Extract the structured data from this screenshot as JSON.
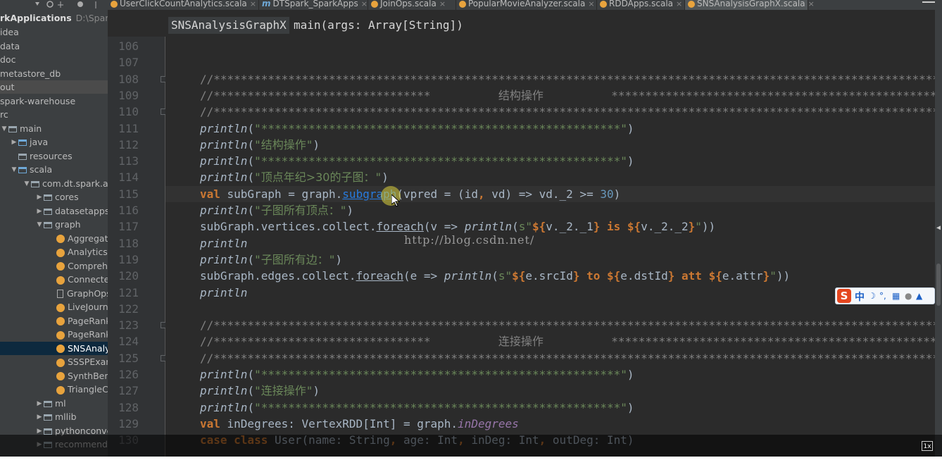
{
  "tabs": [
    {
      "label": "UserClickCountAnalytics.scala",
      "icon": "scala",
      "active": false
    },
    {
      "label": "DTSpark_SparkApps",
      "icon": "module",
      "active": false
    },
    {
      "label": "JoinOps.scala",
      "icon": "scala",
      "active": false
    },
    {
      "label": "PopularMovieAnalyzer.scala",
      "icon": "scala",
      "active": false
    },
    {
      "label": "RDDApps.scala",
      "icon": "scala",
      "active": false
    },
    {
      "label": "SNSAnalysisGraphX.scala",
      "icon": "scala",
      "active": true
    }
  ],
  "tab_close_glyph": "×",
  "project": {
    "name": "rkApplications",
    "path": "D:\\SparkA"
  },
  "tree": [
    {
      "label": "idea",
      "arrow": "",
      "icon": "none"
    },
    {
      "label": "data",
      "arrow": "",
      "icon": "none"
    },
    {
      "label": "doc",
      "arrow": "",
      "icon": "none"
    },
    {
      "label": "metastore_db",
      "arrow": "",
      "icon": "none"
    },
    {
      "label": "out",
      "arrow": "",
      "icon": "none"
    },
    {
      "label": "spark-warehouse",
      "arrow": "",
      "icon": "none"
    },
    {
      "label": "rc",
      "arrow": "",
      "icon": "none"
    },
    {
      "label": "main",
      "arrow": "▼",
      "icon": "folder"
    },
    {
      "label": "java",
      "arrow": "▶",
      "icon": "folder-blue"
    },
    {
      "label": "resources",
      "arrow": "",
      "icon": "folder"
    },
    {
      "label": "scala",
      "arrow": "▼",
      "icon": "folder-blue"
    },
    {
      "label": "com.dt.spark.apps",
      "arrow": "▼",
      "icon": "folder"
    },
    {
      "label": "cores",
      "arrow": "▶",
      "icon": "folder"
    },
    {
      "label": "datasetapps",
      "arrow": "▶",
      "icon": "folder"
    },
    {
      "label": "graph",
      "arrow": "▼",
      "icon": "folder"
    },
    {
      "label": "AggregateM",
      "arrow": "",
      "icon": "scala"
    },
    {
      "label": "Analytics",
      "arrow": "",
      "icon": "scala"
    },
    {
      "label": "Comprehen",
      "arrow": "",
      "icon": "scala"
    },
    {
      "label": "Connected",
      "arrow": "",
      "icon": "scala"
    },
    {
      "label": "GraphOpsIn",
      "arrow": "",
      "icon": "file"
    },
    {
      "label": "LiveJournal",
      "arrow": "",
      "icon": "scala"
    },
    {
      "label": "PageRankA",
      "arrow": "",
      "icon": "scala"
    },
    {
      "label": "PageRankE",
      "arrow": "",
      "icon": "scala"
    },
    {
      "label": "SNSAnalysi",
      "arrow": "",
      "icon": "scala"
    },
    {
      "label": "SSSPExamp",
      "arrow": "",
      "icon": "scala"
    },
    {
      "label": "SynthBench",
      "arrow": "",
      "icon": "scala"
    },
    {
      "label": "TriangleCou",
      "arrow": "",
      "icon": "scala"
    },
    {
      "label": "ml",
      "arrow": "▶",
      "icon": "folder"
    },
    {
      "label": "mllib",
      "arrow": "▶",
      "icon": "folder"
    },
    {
      "label": "pythonconvert",
      "arrow": "▶",
      "icon": "folder"
    },
    {
      "label": "recommendati",
      "arrow": "▶",
      "icon": "folder"
    }
  ],
  "breadcrumb": {
    "class_name": "SNSAnalysisGraphX",
    "method": "main(args: Array[String])"
  },
  "line_numbers": [
    "106",
    "107",
    "108",
    "109",
    "110",
    "111",
    "112",
    "113",
    "114",
    "115",
    "116",
    "117",
    "118",
    "119",
    "120",
    "121",
    "122",
    "123",
    "124",
    "125",
    "126",
    "127",
    "128",
    "129",
    "130"
  ],
  "code_lines": [
    [],
    [],
    [
      [
        "cmt",
        "//****************************************************************************************************************"
      ]
    ],
    [
      [
        "cmt",
        "//********************************          "
      ],
      [
        "cmt-cn",
        "结构操作"
      ],
      [
        "cmt",
        "          ***********************************************************"
      ]
    ],
    [
      [
        "cmt",
        "//****************************************************************************************************************"
      ]
    ],
    [
      [
        "fn",
        "println"
      ],
      [
        "meth",
        "("
      ],
      [
        "str",
        "\"*****************************************************\""
      ],
      [
        "meth",
        ")"
      ]
    ],
    [
      [
        "fn",
        "println"
      ],
      [
        "meth",
        "("
      ],
      [
        "str",
        "\""
      ],
      [
        "str-cn",
        "结构操作"
      ],
      [
        "str",
        "\""
      ],
      [
        "meth",
        ")"
      ]
    ],
    [
      [
        "fn",
        "println"
      ],
      [
        "meth",
        "("
      ],
      [
        "str",
        "\"*****************************************************\""
      ],
      [
        "meth",
        ")"
      ]
    ],
    [
      [
        "fn",
        "println"
      ],
      [
        "meth",
        "("
      ],
      [
        "str",
        "\""
      ],
      [
        "str-cn",
        "顶点年纪>30的子图："
      ],
      [
        "str",
        "\""
      ],
      [
        "meth",
        ")"
      ]
    ],
    [
      [
        "kw",
        "val "
      ],
      [
        "meth",
        "subGraph = graph."
      ],
      [
        "link",
        "subgraph"
      ],
      [
        "meth",
        "(vpred = (id"
      ],
      [
        "kw",
        ", "
      ],
      [
        "meth",
        "vd) => vd._2 >= "
      ],
      [
        "num",
        "30"
      ],
      [
        "meth",
        ")"
      ]
    ],
    [
      [
        "fn",
        "println"
      ],
      [
        "meth",
        "("
      ],
      [
        "str",
        "\""
      ],
      [
        "str-cn",
        "子图所有顶点："
      ],
      [
        "str",
        "\""
      ],
      [
        "meth",
        ")"
      ]
    ],
    [
      [
        "meth",
        "subGraph.vertices.collect."
      ],
      [
        "underline",
        "foreach"
      ],
      [
        "meth",
        "(v => "
      ],
      [
        "fn",
        "println"
      ],
      [
        "meth",
        "("
      ],
      [
        "str",
        "s\""
      ],
      [
        "interp",
        "${"
      ],
      [
        "meth",
        "v._2._1"
      ],
      [
        "interp",
        "}"
      ],
      [
        "str",
        " "
      ],
      [
        "kw",
        "is"
      ],
      [
        "str",
        " "
      ],
      [
        "interp",
        "${"
      ],
      [
        "meth",
        "v._2._2"
      ],
      [
        "interp",
        "}"
      ],
      [
        "str",
        "\""
      ],
      [
        "meth",
        "))"
      ]
    ],
    [
      [
        "fn",
        "println"
      ]
    ],
    [
      [
        "fn",
        "println"
      ],
      [
        "meth",
        "("
      ],
      [
        "str",
        "\""
      ],
      [
        "str-cn",
        "子图所有边："
      ],
      [
        "str",
        "\""
      ],
      [
        "meth",
        ")"
      ]
    ],
    [
      [
        "meth",
        "subGraph.edges.collect."
      ],
      [
        "underline",
        "foreach"
      ],
      [
        "meth",
        "(e => "
      ],
      [
        "fn",
        "println"
      ],
      [
        "meth",
        "("
      ],
      [
        "str",
        "s\""
      ],
      [
        "interp",
        "${"
      ],
      [
        "meth",
        "e.srcId"
      ],
      [
        "interp",
        "}"
      ],
      [
        "str",
        " "
      ],
      [
        "kw",
        "to"
      ],
      [
        "str",
        " "
      ],
      [
        "interp",
        "${"
      ],
      [
        "meth",
        "e.dstId"
      ],
      [
        "interp",
        "}"
      ],
      [
        "str",
        " "
      ],
      [
        "kw",
        "att"
      ],
      [
        "str",
        " "
      ],
      [
        "interp",
        "${"
      ],
      [
        "meth",
        "e.attr"
      ],
      [
        "interp",
        "}"
      ],
      [
        "str",
        "\""
      ],
      [
        "meth",
        "))"
      ]
    ],
    [
      [
        "fn",
        "println"
      ]
    ],
    [],
    [
      [
        "cmt",
        "//****************************************************************************************************************"
      ]
    ],
    [
      [
        "cmt",
        "//********************************          "
      ],
      [
        "cmt-cn",
        "连接操作"
      ],
      [
        "cmt",
        "          ***********************************************************"
      ]
    ],
    [
      [
        "cmt",
        "//****************************************************************************************************************"
      ]
    ],
    [
      [
        "fn",
        "println"
      ],
      [
        "meth",
        "("
      ],
      [
        "str",
        "\"*****************************************************\""
      ],
      [
        "meth",
        ")"
      ]
    ],
    [
      [
        "fn",
        "println"
      ],
      [
        "meth",
        "("
      ],
      [
        "str",
        "\""
      ],
      [
        "str-cn",
        "连接操作"
      ],
      [
        "str",
        "\""
      ],
      [
        "meth",
        ")"
      ]
    ],
    [
      [
        "fn",
        "println"
      ],
      [
        "meth",
        "("
      ],
      [
        "str",
        "\"*****************************************************\""
      ],
      [
        "meth",
        ")"
      ]
    ],
    [
      [
        "kw",
        "val "
      ],
      [
        "meth",
        "inDegrees: VertexRDD[Int] = graph."
      ],
      [
        "prop",
        "inDegrees"
      ]
    ],
    [
      [
        "kw",
        "case class "
      ],
      [
        "meth",
        "User(name: String"
      ],
      [
        "kw",
        ", "
      ],
      [
        "meth",
        "age: Int"
      ],
      [
        "kw",
        ", "
      ],
      [
        "meth",
        "inDeg: Int"
      ],
      [
        "kw",
        ", "
      ],
      [
        "meth",
        "outDeg: Int)"
      ]
    ]
  ],
  "watermark": "http://blog.csdn.net/",
  "ime": {
    "logo": "S",
    "lang": "中"
  },
  "speed_badge": "1x"
}
